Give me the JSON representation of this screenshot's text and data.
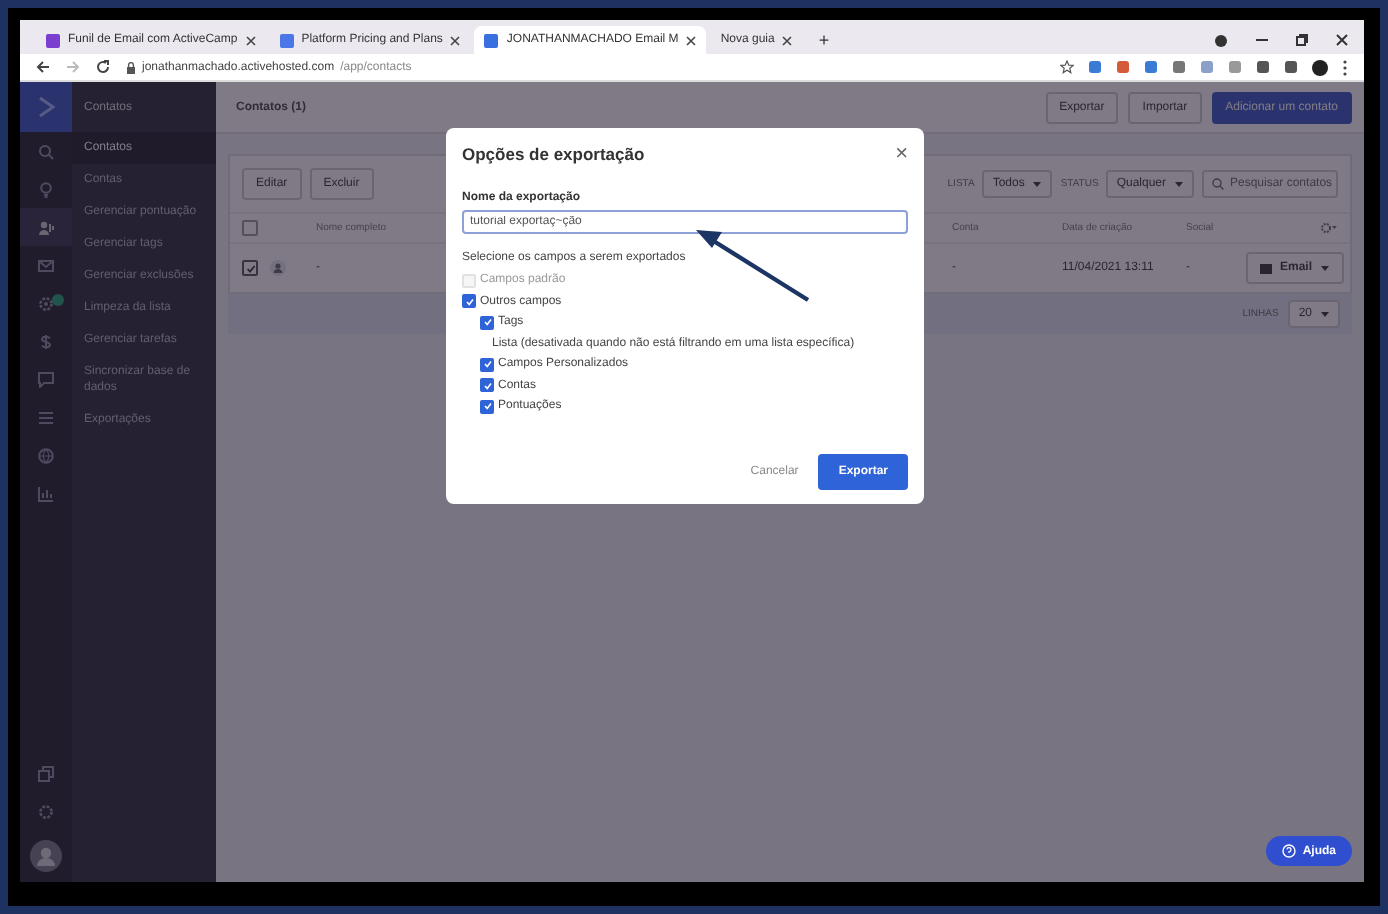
{
  "browser": {
    "tabs": [
      {
        "title": "Funil de Email com ActiveCamp",
        "selected": false
      },
      {
        "title": "Platform Pricing and Plans",
        "selected": false
      },
      {
        "title": "JONATHANMACHADO Email M",
        "selected": true
      },
      {
        "title": "Nova guia",
        "selected": false
      }
    ],
    "new_tab": "+",
    "url_host": "jonathanmachado.activehosted.com",
    "url_path": "/app/contacts"
  },
  "sidebar": {
    "section": "Contatos",
    "items": [
      {
        "label": "Contatos",
        "selected": true
      },
      {
        "label": "Contas",
        "selected": false
      },
      {
        "label": "Gerenciar pontuação",
        "selected": false
      },
      {
        "label": "Gerenciar tags",
        "selected": false
      },
      {
        "label": "Gerenciar exclusões",
        "selected": false
      },
      {
        "label": "Limpeza da lista",
        "selected": false
      },
      {
        "label": "Gerenciar tarefas",
        "selected": false
      },
      {
        "label": "Sincronizar base de dados",
        "selected": false
      },
      {
        "label": "Exportações",
        "selected": false
      }
    ]
  },
  "contacts": {
    "title": "Contatos (1)",
    "actions": [
      "Exportar",
      "Importar",
      "Adicionar um contato"
    ],
    "toolbar": [
      "Editar",
      "Excluir"
    ],
    "filters": [
      {
        "label": "LISTA",
        "value": "Todos"
      },
      {
        "label": "STATUS",
        "value": "Qualquer"
      }
    ],
    "search_placeholder": "Pesquisar contatos",
    "select_all_checked": false,
    "columns": [
      "Nome completo",
      "Conta",
      "Data de criação",
      "Social"
    ],
    "rows": [
      {
        "checked": true,
        "name": "-",
        "account": "-",
        "created": "11/04/2021 13:11",
        "social": "-",
        "action": "Email"
      }
    ],
    "rows_label": "LINHAS",
    "rows_per_page": "20"
  },
  "modal": {
    "title": "Opções de exportação",
    "close": "×",
    "name_label": "Nome da exportação",
    "name_value": "tutorial exportaç~ção",
    "fields_label": "Selecione os campos a serem exportados",
    "options": [
      {
        "kind": "checkbox",
        "label": "Campos padrão",
        "checked": false,
        "disabled": true
      },
      {
        "kind": "checkbox",
        "label": "Outros campos",
        "checked": true,
        "disabled": false,
        "children": [
          {
            "kind": "checkbox",
            "label": "Tags",
            "checked": true,
            "disabled": false
          },
          {
            "kind": "text",
            "label": "Lista (desativada quando não está filtrando em uma lista específica)"
          },
          {
            "kind": "checkbox",
            "label": "Campos Personalizados",
            "checked": true,
            "disabled": false
          },
          {
            "kind": "checkbox",
            "label": "Contas",
            "checked": true,
            "disabled": false
          },
          {
            "kind": "checkbox",
            "label": "Pontuações",
            "checked": true,
            "disabled": false
          }
        ]
      }
    ],
    "cancel": "Cancelar",
    "confirm": "Exportar"
  },
  "help": "Ajuda"
}
